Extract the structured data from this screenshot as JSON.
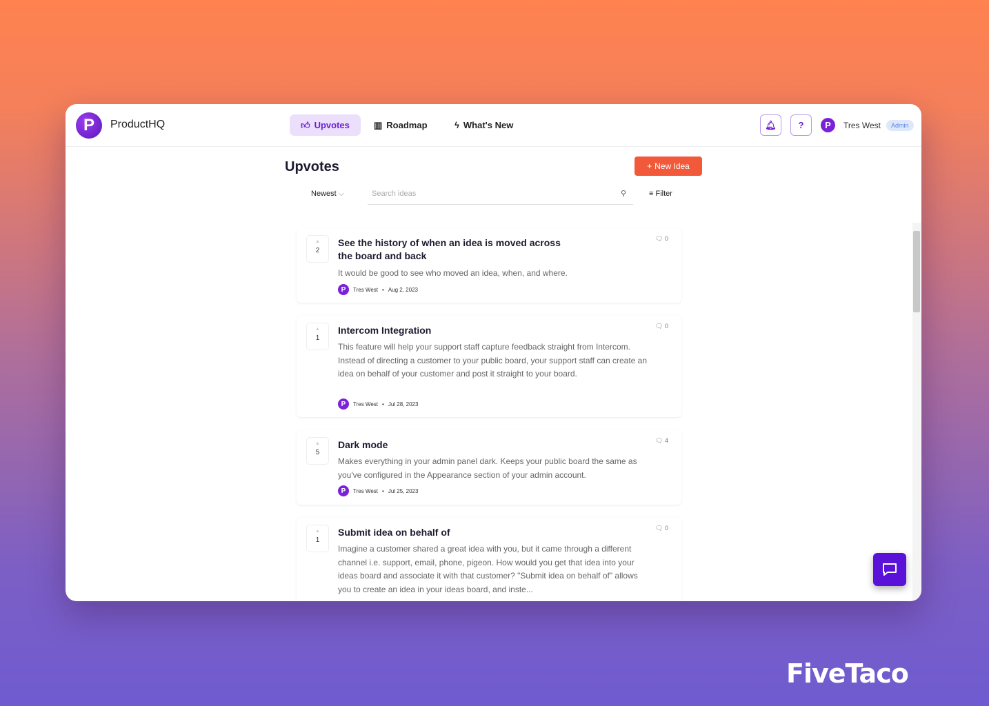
{
  "app": {
    "name": "ProductHQ",
    "logo_letter": "P"
  },
  "nav": [
    {
      "label": "Upvotes",
      "icon": "thumbs-up-icon",
      "active": true
    },
    {
      "label": "Roadmap",
      "icon": "columns-icon"
    },
    {
      "label": "What's New",
      "icon": "lightning-icon"
    }
  ],
  "user": {
    "name": "Tres West",
    "role": "Admin",
    "initial": "P"
  },
  "header": {
    "help": "?"
  },
  "page": {
    "title": "Upvotes",
    "new_idea": "New Idea",
    "sort": "Newest",
    "search_placeholder": "Search ideas",
    "filter": "Filter"
  },
  "ideas": [
    {
      "votes": "2",
      "title": "See the history of when an idea is moved across the board and back",
      "desc": "It would be good to see who moved an idea, when, and where.",
      "author": "Tres West",
      "date": "Aug 2, 2023",
      "comments": "0"
    },
    {
      "votes": "1",
      "title": "Intercom Integration",
      "desc": "This feature will help your support staff capture feedback straight from Intercom. Instead of directing a customer to your public board, your support staff can create an idea on behalf of your customer and post it straight to your board.",
      "author": "Tres West",
      "date": "Jul 28, 2023",
      "comments": "0"
    },
    {
      "votes": "5",
      "title": "Dark mode",
      "desc": "Makes everything in your admin panel dark. Keeps your public board the same as you've configured in the Appearance section of your admin account.",
      "author": "Tres West",
      "date": "Jul 25, 2023",
      "comments": "4"
    },
    {
      "votes": "1",
      "title": "Submit idea on behalf of",
      "desc": "Imagine a customer shared a great idea with you, but it came through a different channel i.e. support, email, phone, pigeon. How would you get that idea into your ideas board and associate it with that customer? \"Submit idea on behalf of\" allows you to create an idea in your ideas board, and inste...",
      "author": "Tres West",
      "date": "",
      "comments": "0"
    }
  ],
  "watermark": "FiveTaco",
  "colors": {
    "accent": "#6a1fd0",
    "new_idea": "#f2583a"
  }
}
